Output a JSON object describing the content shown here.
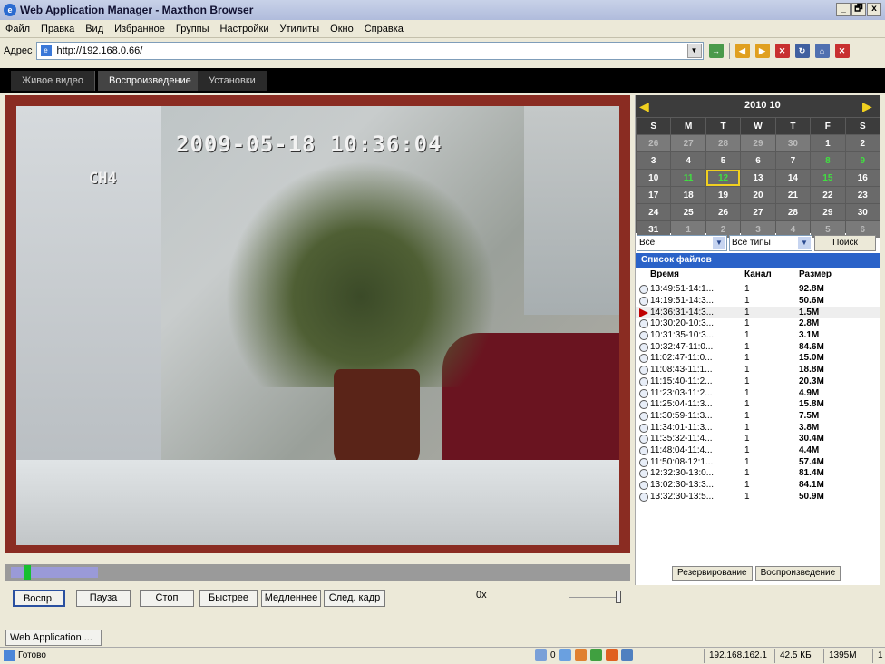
{
  "window": {
    "title": "Web Application Manager - Maxthon Browser",
    "buttons": [
      "_",
      "🗗",
      "x"
    ]
  },
  "menu": [
    "Файл",
    "Правка",
    "Вид",
    "Избранное",
    "Группы",
    "Настройки",
    "Утилиты",
    "Окно",
    "Справка"
  ],
  "address": {
    "label": "Адрес",
    "url": "http://192.168.0.66/"
  },
  "nav_tabs": [
    "Живое видео",
    "Воспроизведение",
    "Установки"
  ],
  "video": {
    "timestamp": "2009-05-18 10:36:04",
    "channel": "CH4"
  },
  "controls": {
    "buttons": [
      "Воспр.",
      "Пауза",
      "Стоп",
      "Быстрее",
      "Медленнее",
      "След. кадр"
    ],
    "speed": "0x"
  },
  "timeline": {
    "position": 0.02,
    "recorded_fraction": 0.14
  },
  "calendar": {
    "month": "2010 10",
    "weekdays": [
      "S",
      "M",
      "T",
      "W",
      "T",
      "F",
      "S"
    ],
    "weeks": [
      [
        "26",
        "27",
        "28",
        "29",
        "30",
        "1",
        "2"
      ],
      [
        "3",
        "4",
        "5",
        "6",
        "7",
        "8",
        "9"
      ],
      [
        "10",
        "11",
        "12",
        "13",
        "14",
        "15",
        "16"
      ],
      [
        "17",
        "18",
        "19",
        "20",
        "21",
        "22",
        "23"
      ],
      [
        "24",
        "25",
        "26",
        "27",
        "28",
        "29",
        "30"
      ],
      [
        "31",
        "1",
        "2",
        "3",
        "4",
        "5",
        "6"
      ]
    ],
    "recorded_days": [
      "8",
      "9",
      "11",
      "12",
      "15"
    ],
    "selected_day": "12"
  },
  "filters": {
    "channel": "Все",
    "type": "Все типы",
    "search_label": "Поиск"
  },
  "file_list": {
    "title": "Список файлов",
    "headers": {
      "time": "Время",
      "channel": "Канал",
      "size": "Размер"
    },
    "rows": [
      {
        "time": "13:49:51-14:1...",
        "channel": "1",
        "size": "92.8M"
      },
      {
        "time": "14:19:51-14:3...",
        "channel": "1",
        "size": "50.6M"
      },
      {
        "time": "14:36:31-14:3...",
        "channel": "1",
        "size": "1.5M"
      },
      {
        "time": "10:30:20-10:3...",
        "channel": "1",
        "size": "2.8M"
      },
      {
        "time": "10:31:35-10:3...",
        "channel": "1",
        "size": "3.1M"
      },
      {
        "time": "10:32:47-11:0...",
        "channel": "1",
        "size": "84.6M"
      },
      {
        "time": "11:02:47-11:0...",
        "channel": "1",
        "size": "15.0M"
      },
      {
        "time": "11:08:43-11:1...",
        "channel": "1",
        "size": "18.8M"
      },
      {
        "time": "11:15:40-11:2...",
        "channel": "1",
        "size": "20.3M"
      },
      {
        "time": "11:23:03-11:2...",
        "channel": "1",
        "size": "4.9M"
      },
      {
        "time": "11:25:04-11:3...",
        "channel": "1",
        "size": "15.8M"
      },
      {
        "time": "11:30:59-11:3...",
        "channel": "1",
        "size": "7.5M"
      },
      {
        "time": "11:34:01-11:3...",
        "channel": "1",
        "size": "3.8M"
      },
      {
        "time": "11:35:32-11:4...",
        "channel": "1",
        "size": "30.4M"
      },
      {
        "time": "11:48:04-11:4...",
        "channel": "1",
        "size": "4.4M"
      },
      {
        "time": "11:50:08-12:1...",
        "channel": "1",
        "size": "57.4M"
      },
      {
        "time": "12:32:30-13:0...",
        "channel": "1",
        "size": "81.4M"
      },
      {
        "time": "13:02:30-13:3...",
        "channel": "1",
        "size": "84.1M"
      },
      {
        "time": "13:32:30-13:5...",
        "channel": "1",
        "size": "50.9M"
      }
    ],
    "current_index": 2
  },
  "side_buttons": [
    "Резервирование",
    "Воспроизведение"
  ],
  "taskbar": {
    "item": "Web Application ..."
  },
  "status": {
    "text": "Готово",
    "tray_count": "0",
    "ip": "192.168.162.1",
    "kb": "42.5 КБ",
    "mem": "1395M",
    "page": "1"
  },
  "colors": {
    "frame": "#8a2c22",
    "topnav": "#000000",
    "list_title": "#2a62c8",
    "recorded_day": "#40e040",
    "selected_border": "#f0d020"
  }
}
